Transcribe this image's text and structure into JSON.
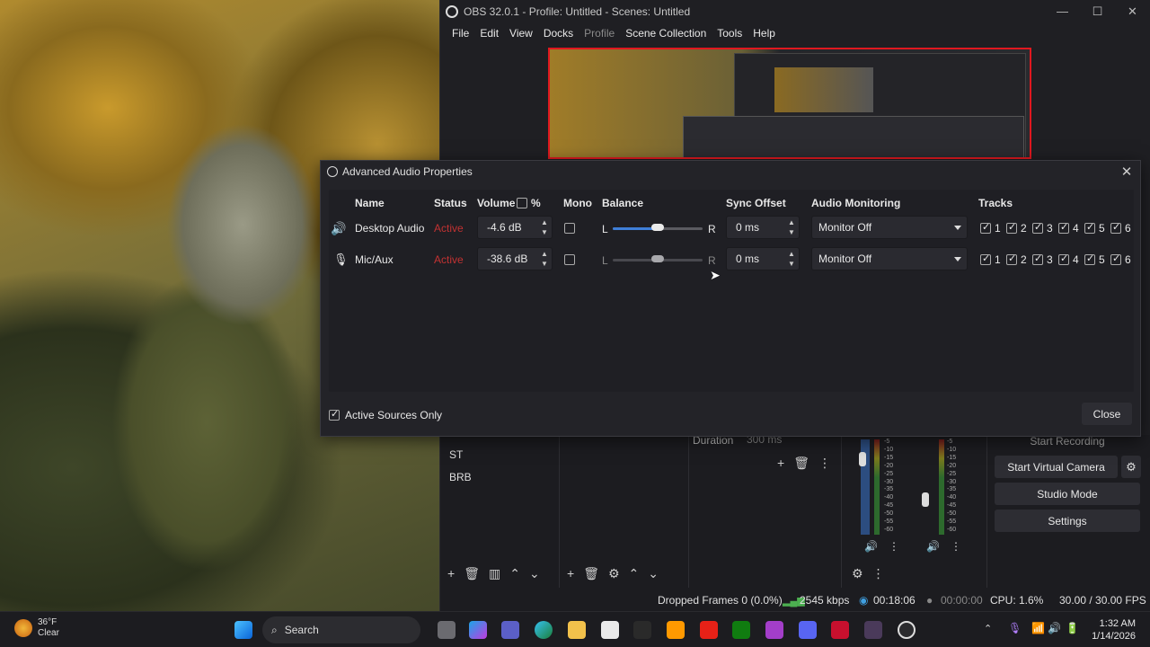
{
  "obs": {
    "title": "OBS 32.0.1 - Profile: Untitled - Scenes: Untitled",
    "menu": [
      "File",
      "Edit",
      "View",
      "Docks",
      "Profile",
      "Scene Collection",
      "Tools",
      "Help"
    ],
    "scenes": [
      "ST",
      "BRB"
    ],
    "duration_label": "Duration",
    "duration_value": "300 ms",
    "controls": {
      "start_recording": "Start Recording",
      "start_virtual_camera": "Start Virtual Camera",
      "studio_mode": "Studio Mode",
      "settings": "Settings"
    },
    "status": {
      "dropped_frames": "Dropped Frames 0 (0.0%)",
      "bitrate": "2545 kbps",
      "stream_time": "00:18:06",
      "record_time": "00:00:00",
      "cpu": "CPU: 1.6%",
      "fps": "30.00 / 30.00 FPS"
    },
    "meter_ticks": [
      "-5",
      "-10",
      "-15",
      "-20",
      "-25",
      "-30",
      "-35",
      "-40",
      "-45",
      "-50",
      "-55",
      "-60"
    ]
  },
  "dialog": {
    "title": "Advanced Audio Properties",
    "headers": {
      "name": "Name",
      "status": "Status",
      "volume": "Volume",
      "percent": "%",
      "mono": "Mono",
      "balance": "Balance",
      "sync_offset": "Sync Offset",
      "audio_monitoring": "Audio Monitoring",
      "tracks": "Tracks"
    },
    "balance_l": "L",
    "balance_r": "R",
    "rows": [
      {
        "icon": "speaker-icon",
        "name": "Desktop Audio",
        "status": "Active",
        "volume": "-4.6 dB",
        "mono": false,
        "balance_fraction": 0.5,
        "sync_offset": "0 ms",
        "monitoring": "Monitor Off",
        "tracks": [
          "1",
          "2",
          "3",
          "4",
          "5",
          "6"
        ]
      },
      {
        "icon": "microphone-icon",
        "name": "Mic/Aux",
        "status": "Active",
        "volume": "-38.6 dB",
        "mono": false,
        "balance_fraction": 0.5,
        "sync_offset": "0 ms",
        "monitoring": "Monitor Off",
        "tracks": [
          "1",
          "2",
          "3",
          "4",
          "5",
          "6"
        ]
      }
    ],
    "active_sources_only": "Active Sources Only",
    "close_button": "Close"
  },
  "taskbar": {
    "weather_temp": "36°F",
    "weather_desc": "Clear",
    "search": "Search",
    "time": "1:32 AM",
    "date": "1/14/2026"
  },
  "colors": {
    "active_status": "#c23232",
    "preview_border": "#e0181f",
    "slider_fill": "#3f7fd8"
  }
}
